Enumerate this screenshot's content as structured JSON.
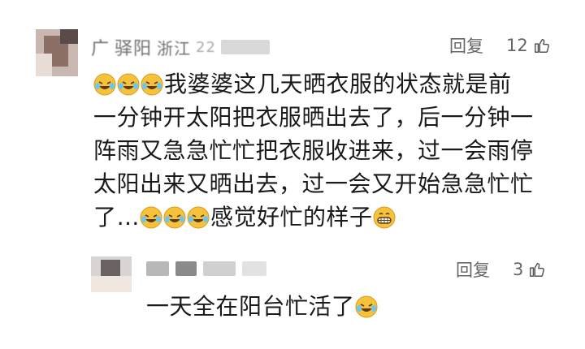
{
  "comments": [
    {
      "author_fragments": [
        "广",
        "驿阳",
        "浙江",
        "22"
      ],
      "reply_label": "回复",
      "likes": "12",
      "lines": [
        {
          "emoji_prefix": 3,
          "text": "我婆婆这几天晒衣服的状态就是前"
        },
        {
          "text": "一分钟开太阳把衣服晒出去了，后一分钟一"
        },
        {
          "text": "阵雨又急急忙忙把衣服收进来，过一会雨停"
        },
        {
          "text": "太阳出来又晒出去，过一会又开始急急忙忙"
        },
        {
          "text": "了…",
          "emoji_after": 3,
          "text2": "感觉好忙的样子",
          "grin_after": true
        }
      ]
    },
    {
      "reply_label": "回复",
      "likes": "3",
      "lines": [
        {
          "text": "一天全在阳台忙活了",
          "emoji_after": 1
        }
      ]
    }
  ],
  "icons": [
    "laughing-crying-emoji",
    "grinning-emoji",
    "thumbs-up-icon"
  ],
  "colors": {
    "text": "#1a1a1a",
    "meta": "#666666",
    "emoji": "#f7c23b"
  }
}
